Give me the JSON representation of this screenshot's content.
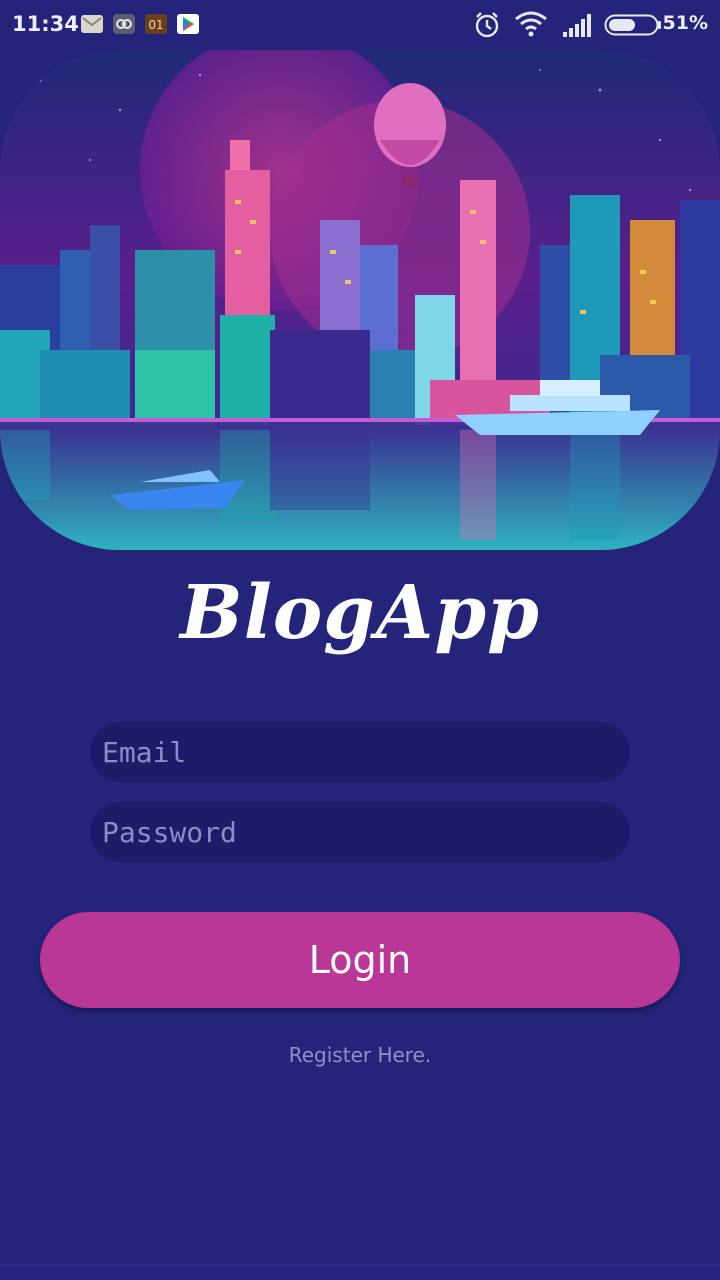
{
  "status_bar": {
    "time": "11:34",
    "battery": "51%",
    "notifications": [
      "mail-icon",
      "app-icon",
      "counter-icon",
      "play-store-icon"
    ],
    "notification_counter_text": "01"
  },
  "app": {
    "title": "BlogApp"
  },
  "form": {
    "email_placeholder": "Email",
    "password_placeholder": "Password",
    "login_label": "Login",
    "register_label": "Register Here."
  },
  "colors": {
    "background": "#23247a",
    "field_bg": "#1c1d68",
    "login_button": "#b83797",
    "register_text": "#8f92c7"
  }
}
